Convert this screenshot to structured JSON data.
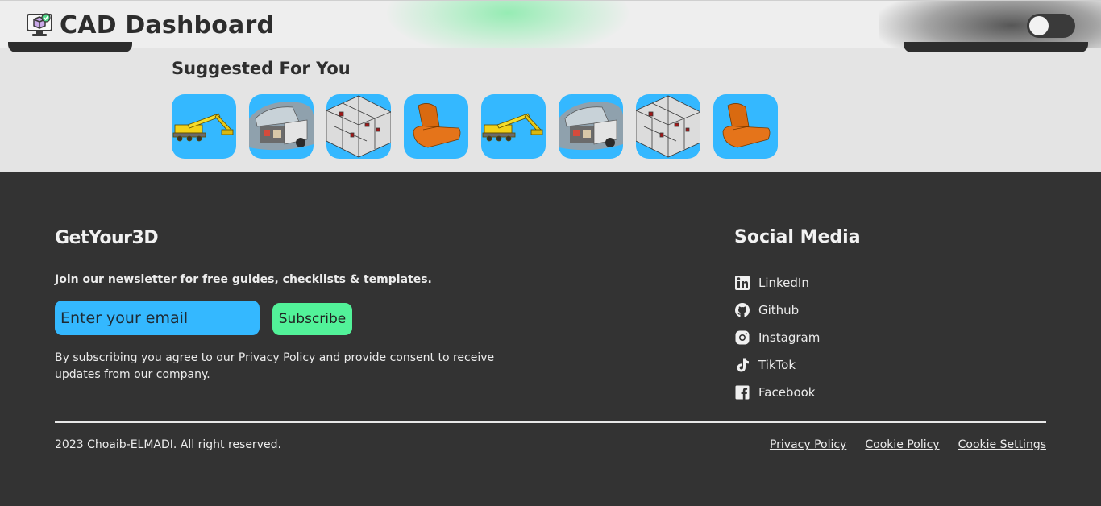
{
  "header": {
    "title": "CAD Dashboard",
    "logo_icon": "cad-monitor-icon",
    "theme_toggle": {
      "state": "off"
    }
  },
  "suggested": {
    "title": "Suggested For You",
    "items": [
      {
        "icon": "crane-model-thumbnail"
      },
      {
        "icon": "car-model-thumbnail"
      },
      {
        "icon": "floorplan-model-thumbnail"
      },
      {
        "icon": "seat-model-thumbnail"
      },
      {
        "icon": "crane-model-thumbnail"
      },
      {
        "icon": "car-model-thumbnail"
      },
      {
        "icon": "floorplan-model-thumbnail"
      },
      {
        "icon": "seat-model-thumbnail"
      }
    ]
  },
  "footer": {
    "brand": "GetYour3D",
    "newsletter_text": "Join our newsletter for free guides, checklists & templates.",
    "email_placeholder": "Enter your email",
    "subscribe_label": "Subscribe",
    "consent_text": "By subscribing you agree to our Privacy Policy and provide consent to receive updates from our company.",
    "social": {
      "title": "Social Media",
      "links": [
        {
          "label": "LinkedIn",
          "icon": "linkedin-icon"
        },
        {
          "label": "Github",
          "icon": "github-icon"
        },
        {
          "label": "Instagram",
          "icon": "instagram-icon"
        },
        {
          "label": "TikTok",
          "icon": "tiktok-icon"
        },
        {
          "label": "Facebook",
          "icon": "facebook-icon"
        }
      ]
    },
    "copyright": "2023 Choaib-ELMADI. All right reserved.",
    "legal_links": [
      "Privacy Policy",
      "Cookie Policy",
      "Cookie Settings"
    ]
  },
  "colors": {
    "accent_blue": "#34b8ff",
    "accent_green": "#52f299",
    "footer_bg": "#333333",
    "page_bg": "#e4e4e4"
  }
}
